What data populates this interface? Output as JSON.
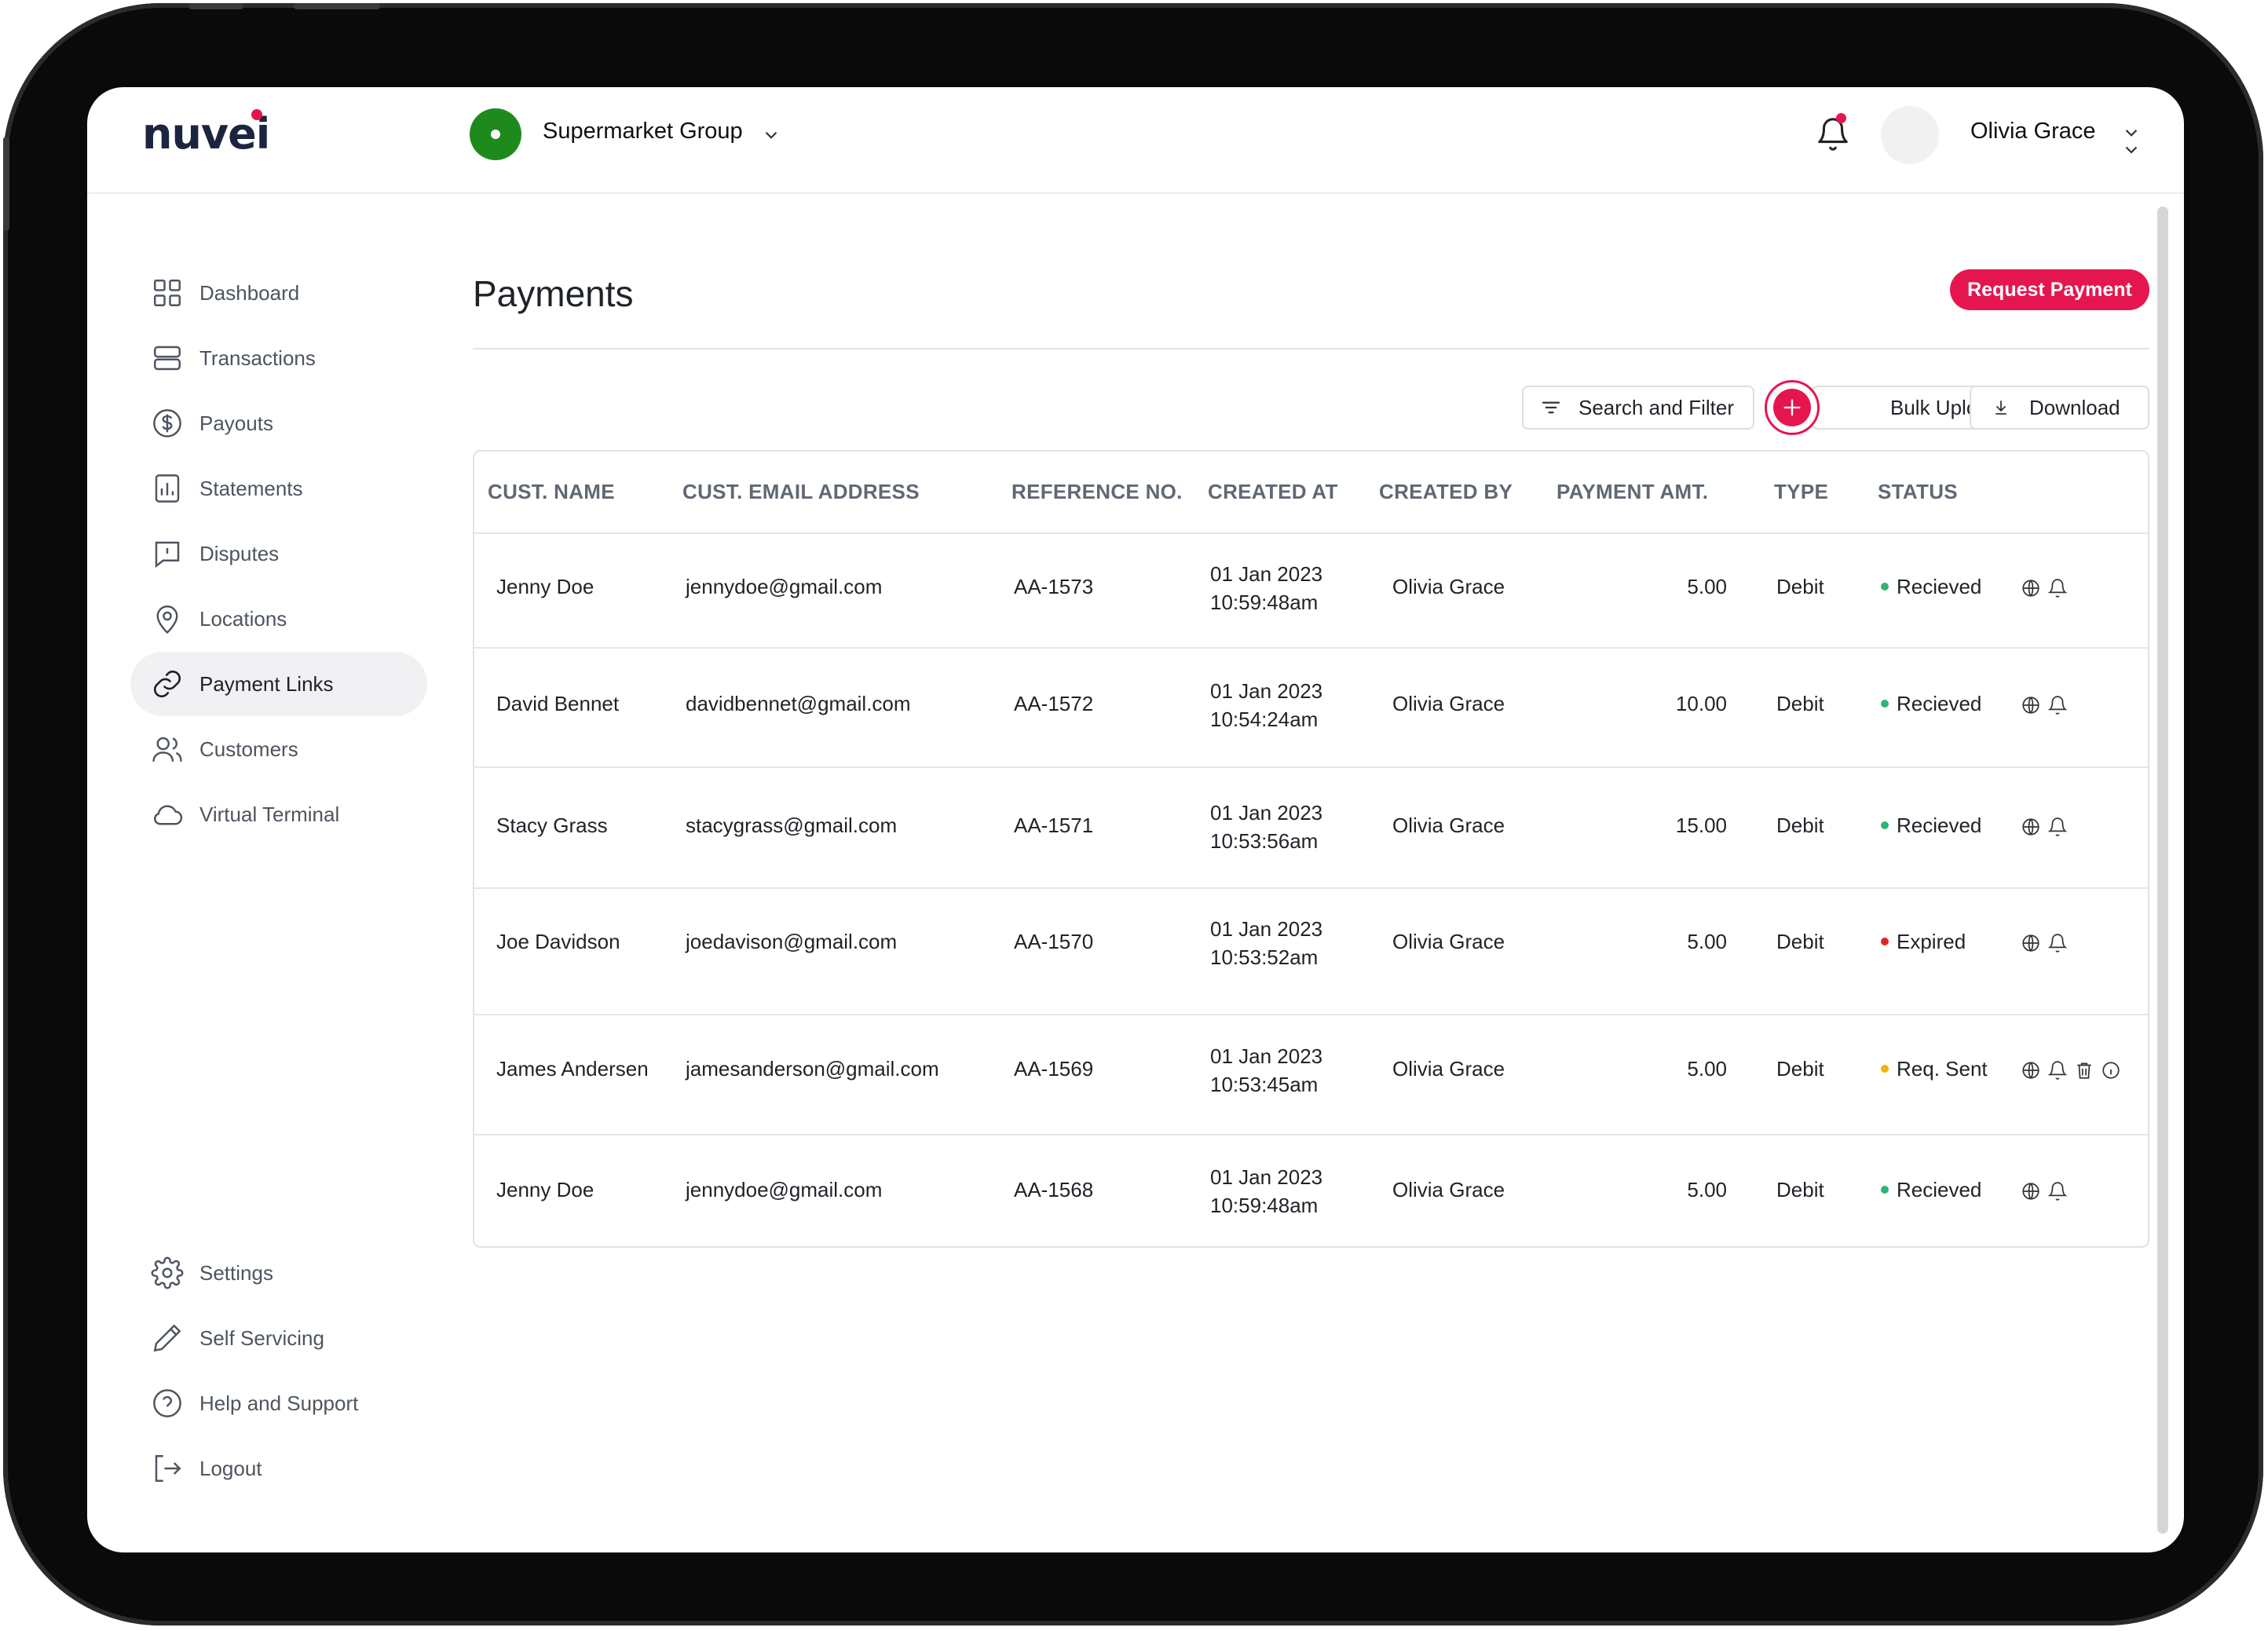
{
  "brand": {
    "logo_text": "nuvei",
    "accent_color": "#e5164f"
  },
  "header": {
    "org_name": "Supermarket Group",
    "org_badge_color": "#1e8a1e",
    "notification_icon": "bell-icon",
    "user_name": "Olivia Grace"
  },
  "sidebar": {
    "items": [
      {
        "label": "Dashboard",
        "icon": "grid-icon"
      },
      {
        "label": "Transactions",
        "icon": "stack-icon"
      },
      {
        "label": "Payouts",
        "icon": "dollar-icon"
      },
      {
        "label": "Statements",
        "icon": "bar-chart-icon"
      },
      {
        "label": "Disputes",
        "icon": "alert-message-icon"
      },
      {
        "label": "Locations",
        "icon": "map-pin-icon"
      },
      {
        "label": "Payment Links",
        "icon": "link-icon",
        "active": true
      },
      {
        "label": "Customers",
        "icon": "users-icon"
      },
      {
        "label": "Virtual Terminal",
        "icon": "cloud-icon"
      }
    ],
    "bottom_items": [
      {
        "label": "Settings",
        "icon": "gear-icon"
      },
      {
        "label": "Self Servicing",
        "icon": "pencil-icon"
      },
      {
        "label": "Help and Support",
        "icon": "help-icon"
      },
      {
        "label": "Logout",
        "icon": "logout-icon"
      }
    ]
  },
  "main": {
    "title": "Payments",
    "request_button": "Request Payment",
    "toolbar": {
      "search_filter": "Search and Filter",
      "bulk_upload": "Bulk Upload",
      "download": "Download"
    },
    "table": {
      "headers": [
        "CUST. NAME",
        "CUST. EMAIL ADDRESS",
        "REFERENCE NO.",
        "CREATED AT",
        "CREATED BY",
        "PAYMENT AMT.",
        "TYPE",
        "STATUS"
      ],
      "rows": [
        {
          "name": "Jenny Doe",
          "email": "jennydoe@gmail.com",
          "ref": "AA-1573",
          "date": "01 Jan 2023",
          "time": "10:59:48am",
          "by": "Olivia Grace",
          "amount": "5.00",
          "type": "Debit",
          "status": "Recieved",
          "status_color": "#2bb673",
          "actions": [
            "globe-icon",
            "bell-icon"
          ]
        },
        {
          "name": "David Bennet",
          "email": "davidbennet@gmail.com",
          "ref": "AA-1572",
          "date": "01 Jan 2023",
          "time": "10:54:24am",
          "by": "Olivia Grace",
          "amount": "10.00",
          "type": "Debit",
          "status": "Recieved",
          "status_color": "#2bb673",
          "actions": [
            "globe-icon",
            "bell-icon"
          ]
        },
        {
          "name": "Stacy Grass",
          "email": "stacygrass@gmail.com",
          "ref": "AA-1571",
          "date": "01 Jan 2023",
          "time": "10:53:56am",
          "by": "Olivia Grace",
          "amount": "15.00",
          "type": "Debit",
          "status": "Recieved",
          "status_color": "#2bb673",
          "actions": [
            "globe-icon",
            "bell-icon"
          ]
        },
        {
          "name": "Joe Davidson",
          "email": "joedavison@gmail.com",
          "ref": "AA-1570",
          "date": "01 Jan 2023",
          "time": "10:53:52am",
          "by": "Olivia Grace",
          "amount": "5.00",
          "type": "Debit",
          "status": "Expired",
          "status_color": "#e02424",
          "actions": [
            "globe-icon",
            "bell-icon"
          ]
        },
        {
          "name": "James Andersen",
          "email": "jamesanderson@gmail.com",
          "ref": "AA-1569",
          "date": "01 Jan 2023",
          "time": "10:53:45am",
          "by": "Olivia Grace",
          "amount": "5.00",
          "type": "Debit",
          "status": "Req. Sent",
          "status_color": "#f5b400",
          "actions": [
            "globe-icon",
            "bell-icon",
            "trash-icon",
            "info-icon"
          ]
        },
        {
          "name": "Jenny Doe",
          "email": "jennydoe@gmail.com",
          "ref": "AA-1568",
          "date": "01 Jan 2023",
          "time": "10:59:48am",
          "by": "Olivia Grace",
          "amount": "5.00",
          "type": "Debit",
          "status": "Recieved",
          "status_color": "#2bb673",
          "actions": [
            "globe-icon",
            "bell-icon"
          ]
        }
      ]
    }
  }
}
